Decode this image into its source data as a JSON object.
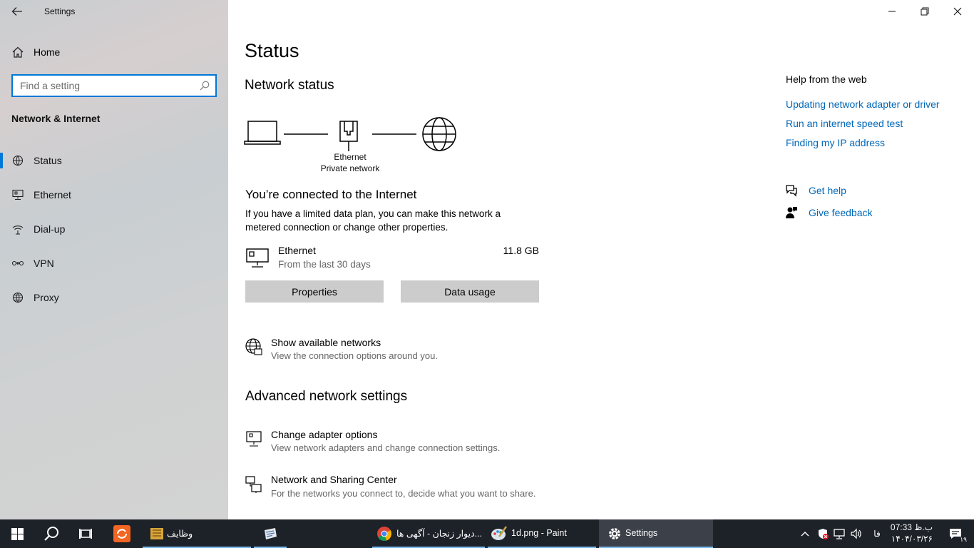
{
  "window": {
    "title": "Settings",
    "controls": {
      "minimize": "minimize",
      "maximize": "restore",
      "close": "close"
    }
  },
  "sidebar": {
    "home_label": "Home",
    "search_placeholder": "Find a setting",
    "section_title": "Network & Internet",
    "items": [
      {
        "label": "Status",
        "icon": "status-icon",
        "selected": true
      },
      {
        "label": "Ethernet",
        "icon": "ethernet-icon",
        "selected": false
      },
      {
        "label": "Dial-up",
        "icon": "dialup-icon",
        "selected": false
      },
      {
        "label": "VPN",
        "icon": "vpn-icon",
        "selected": false
      },
      {
        "label": "Proxy",
        "icon": "proxy-icon",
        "selected": false
      }
    ]
  },
  "main": {
    "title": "Status",
    "network_status_heading": "Network status",
    "diagram": {
      "adapter_name": "Ethernet",
      "network_type": "Private network"
    },
    "connected_heading": "You’re connected to the Internet",
    "connected_desc": "If you have a limited data plan, you can make this network a metered connection or change other properties.",
    "usage": {
      "name": "Ethernet",
      "period": "From the last 30 days",
      "amount": "11.8 GB"
    },
    "buttons": {
      "properties": "Properties",
      "data_usage": "Data usage"
    },
    "show_networks": {
      "title": "Show available networks",
      "subtitle": "View the connection options around you."
    },
    "advanced_heading": "Advanced network settings",
    "adapter_options": {
      "title": "Change adapter options",
      "subtitle": "View network adapters and change connection settings."
    },
    "sharing_center": {
      "title": "Network and Sharing Center",
      "subtitle": "For the networks you connect to, decide what you want to share."
    }
  },
  "help": {
    "title": "Help from the web",
    "links": [
      "Updating network adapter or driver",
      "Run an internet speed test",
      "Finding my IP address"
    ],
    "get_help": "Get help",
    "give_feedback": "Give feedback"
  },
  "taskbar": {
    "apps": [
      {
        "label": "وظایف",
        "icon": "folder-icon"
      },
      {
        "label": "",
        "icon": "paper-icon"
      },
      {
        "label": "دیوار زنجان - آگهی ها...",
        "icon": "chrome-icon"
      },
      {
        "label": "1d.png - Paint",
        "icon": "paint-icon"
      },
      {
        "label": "Settings",
        "icon": "gear-icon"
      }
    ],
    "language": "فا",
    "time": "07:33 ب.ظ",
    "date": "۱۴۰۴/۰۳/۲۶",
    "notification_count": "۱۹",
    "accent": "#0078d7"
  }
}
